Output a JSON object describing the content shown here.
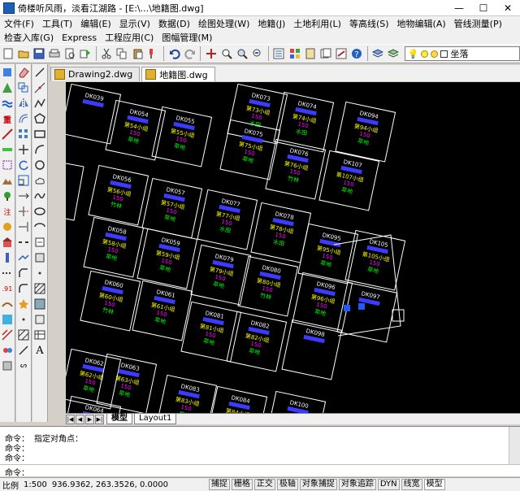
{
  "window": {
    "title": "倚楼听风雨，淡看江湖路 - [E:\\...\\地籍图.dwg]",
    "minimize": "—",
    "maximize": "☐",
    "close": "✕"
  },
  "menu_row1": [
    "文件(F)",
    "工具(T)",
    "编辑(E)",
    "显示(V)",
    "数据(D)",
    "绘图处理(W)",
    "地籍(J)",
    "土地利用(L)",
    "等高线(S)",
    "地物编辑(A)",
    "管线测量(P)"
  ],
  "menu_row2": [
    "检查入库(G)",
    "Express",
    "工程应用(C)",
    "图幅管理(M)"
  ],
  "toolbar": {
    "layer_name": "坐落",
    "icons": [
      "new-file-icon",
      "open-file-icon",
      "save-icon",
      "print-icon",
      "print-preview-icon",
      "publish-icon",
      "cut-icon",
      "copy-icon",
      "paste-icon",
      "match-properties-icon",
      "undo-icon",
      "redo-icon",
      "pan-icon",
      "zoom-realtime-icon",
      "zoom-window-icon",
      "zoom-previous-icon",
      "properties-icon",
      "design-center-icon",
      "tool-palette-icon",
      "sheet-set-icon",
      "markup-icon",
      "help-icon",
      "layer-manager-icon",
      "layer-previous-icon"
    ]
  },
  "doc_tabs": [
    {
      "label": "Drawing2.dwg",
      "active": false
    },
    {
      "label": "地籍图.dwg",
      "active": true
    }
  ],
  "parcels": [
    {
      "id": "DK039",
      "group": "",
      "area": "",
      "use": ""
    },
    {
      "id": "DK054",
      "group": "第54小组",
      "area": "150",
      "use": "旱地"
    },
    {
      "id": "DK055",
      "group": "第55小组",
      "area": "150",
      "use": "旱地"
    },
    {
      "id": "DK073",
      "group": "第73小组",
      "area": "150",
      "use": "水田"
    },
    {
      "id": "DK074",
      "group": "第74小组",
      "area": "150",
      "use": "水田"
    },
    {
      "id": "DK094",
      "group": "第94小组",
      "area": "150",
      "use": "旱地"
    },
    {
      "id": "DK075",
      "group": "第75小组",
      "area": "150",
      "use": "旱地"
    },
    {
      "id": "DK076",
      "group": "第76小组",
      "area": "150",
      "use": "竹林"
    },
    {
      "id": "DK107",
      "group": "第107小组",
      "area": "150",
      "use": "旱地"
    },
    {
      "id": "DK056",
      "group": "第56小组",
      "area": "150",
      "use": "竹林"
    },
    {
      "id": "DK057",
      "group": "第57小组",
      "area": "150",
      "use": "旱地"
    },
    {
      "id": "DK077",
      "group": "第77小组",
      "area": "150",
      "use": "水田"
    },
    {
      "id": "DK078",
      "group": "第78小组",
      "area": "150",
      "use": "水田"
    },
    {
      "id": "DK058",
      "group": "第58小组",
      "area": "150",
      "use": "旱地"
    },
    {
      "id": "DK059",
      "group": "第59小组",
      "area": "150",
      "use": "旱地"
    },
    {
      "id": "DK095",
      "group": "第95小组",
      "area": "150",
      "use": "旱地"
    },
    {
      "id": "DK105",
      "group": "第105小组",
      "area": "150",
      "use": "旱地"
    },
    {
      "id": "DK079",
      "group": "第79小组",
      "area": "150",
      "use": "旱地"
    },
    {
      "id": "DK080",
      "group": "第80小组",
      "area": "150",
      "use": "竹林"
    },
    {
      "id": "DK060",
      "group": "第60小组",
      "area": "150",
      "use": "竹林"
    },
    {
      "id": "DK061",
      "group": "第61小组",
      "area": "150",
      "use": "旱地"
    },
    {
      "id": "DK096",
      "group": "第96小组",
      "area": "150",
      "use": "旱地"
    },
    {
      "id": "DK097",
      "group": "",
      "area": "",
      "use": ""
    },
    {
      "id": "DK081",
      "group": "第81小组",
      "area": "150",
      "use": "旱地"
    },
    {
      "id": "DK082",
      "group": "第82小组",
      "area": "150",
      "use": "旱地"
    },
    {
      "id": "DK098",
      "group": "",
      "area": "",
      "use": ""
    },
    {
      "id": "DK062",
      "group": "第62小组",
      "area": "150",
      "use": "旱地"
    },
    {
      "id": "DK063",
      "group": "第63小组",
      "area": "150",
      "use": "旱地"
    },
    {
      "id": "DK083",
      "group": "第83小组",
      "area": "150",
      "use": "旱地"
    },
    {
      "id": "DK084",
      "group": "第84小组",
      "area": "",
      "use": ""
    },
    {
      "id": "DK100",
      "group": "",
      "area": "",
      "use": ""
    },
    {
      "id": "DK064",
      "group": "",
      "area": "",
      "use": ""
    }
  ],
  "layout_tabs": {
    "model": "模型",
    "layout1": "Layout1"
  },
  "command": {
    "lines": [
      "命令： 指定对角点：",
      "命令：",
      "命令："
    ],
    "prompt": "命令："
  },
  "status": {
    "scale_label": "比例",
    "scale_value": "1:500",
    "coords": "936.9362, 263.3526, 0.0000",
    "toggles": [
      "捕捉",
      "栅格",
      "正交",
      "极轴",
      "对象捕捉",
      "对象追踪",
      "DYN",
      "线宽",
      "模型"
    ]
  },
  "colors": {
    "canvas_bg": "#000000",
    "parcel_border": "#ffffff",
    "parcel_id": "#ffffff",
    "owner_text": "#3b3bff",
    "group_text": "#ffff00",
    "area_text": "#ff00ff",
    "use_text": "#00ff00",
    "grip": "#1e5bff"
  }
}
